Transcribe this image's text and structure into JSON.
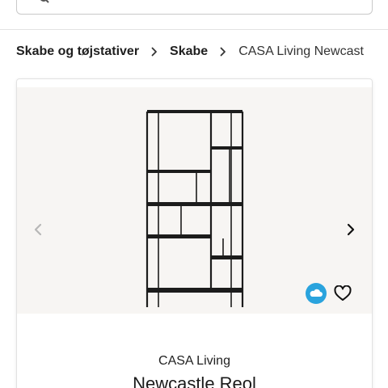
{
  "search": {
    "icon": "search-icon"
  },
  "breadcrumb": {
    "items": [
      {
        "label": "Skabe og tøjstativer"
      },
      {
        "label": "Skabe"
      },
      {
        "label": "CASA Living Newcast"
      }
    ],
    "separator_icon": "chevron-right-icon"
  },
  "product": {
    "brand": "CASA Living",
    "name": "Newcastle Reol",
    "image_icon": "product-image-shelf",
    "prev_icon": "chevron-left-icon",
    "next_icon": "chevron-right-icon",
    "badge_icon": "3d-view-icon",
    "wishlist_icon": "heart-icon"
  },
  "colors": {
    "accent": "#2aa3dd",
    "gallery_bg": "#f7f5f3",
    "text": "#1f1f1f"
  }
}
